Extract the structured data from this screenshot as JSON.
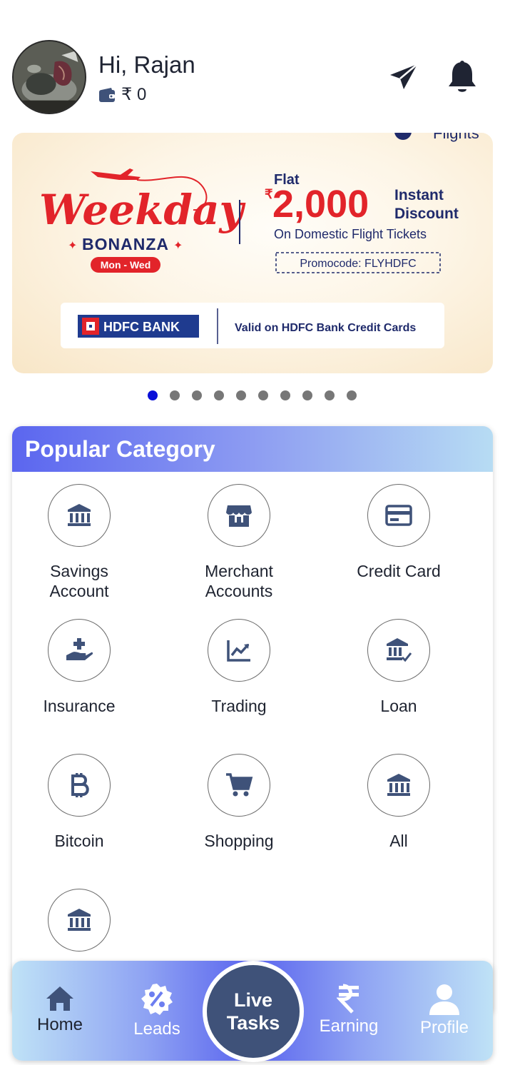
{
  "header": {
    "greeting": "Hi, Rajan",
    "wallet_balance": "₹ 0",
    "icons": [
      "wallet-icon",
      "send-icon",
      "bell-icon"
    ]
  },
  "banner": {
    "flight_tag": "Flights",
    "brand_script": "Weekday",
    "brand_sub": "BONANZA",
    "days": "Mon - Wed",
    "flat": "Flat",
    "currency": "₹",
    "amount": "2,000",
    "instant": "Instant",
    "discount": "Discount",
    "subtitle": "On Domestic Flight Tickets",
    "promo": "Promocode: FLYHDFC",
    "bank": "HDFC BANK",
    "valid": "Valid on HDFC Bank Credit Cards"
  },
  "carousel": {
    "total": 10,
    "active_index": 0
  },
  "category": {
    "title": "Popular Category",
    "items": [
      {
        "label_1": "Savings",
        "label_2": "Account",
        "icon": "bank-icon"
      },
      {
        "label_1": "Merchant",
        "label_2": "Accounts",
        "icon": "store-icon"
      },
      {
        "label_1": "Credit Card",
        "label_2": "",
        "icon": "credit-card-icon"
      },
      {
        "label_1": "Insurance",
        "label_2": "",
        "icon": "insurance-hand-icon"
      },
      {
        "label_1": "Trading",
        "label_2": "",
        "icon": "trading-chart-icon"
      },
      {
        "label_1": "Loan",
        "label_2": "",
        "icon": "loan-bank-check-icon"
      },
      {
        "label_1": "Bitcoin",
        "label_2": "",
        "icon": "bitcoin-icon"
      },
      {
        "label_1": "Shopping",
        "label_2": "",
        "icon": "cart-icon"
      },
      {
        "label_1": "All",
        "label_2": "",
        "icon": "bank-icon"
      },
      {
        "label_1": "",
        "label_2": "",
        "icon": "bank-icon"
      }
    ]
  },
  "nav": {
    "home": "Home",
    "leads": "Leads",
    "live_1": "Live",
    "live_2": "Tasks",
    "earning": "Earning",
    "profile": "Profile"
  },
  "colors": {
    "accent": "#5b66ef",
    "icon": "#3f5279",
    "active_dot": "#0a10d8",
    "banner_red": "#e2242a",
    "banner_navy": "#1f2a6b"
  }
}
